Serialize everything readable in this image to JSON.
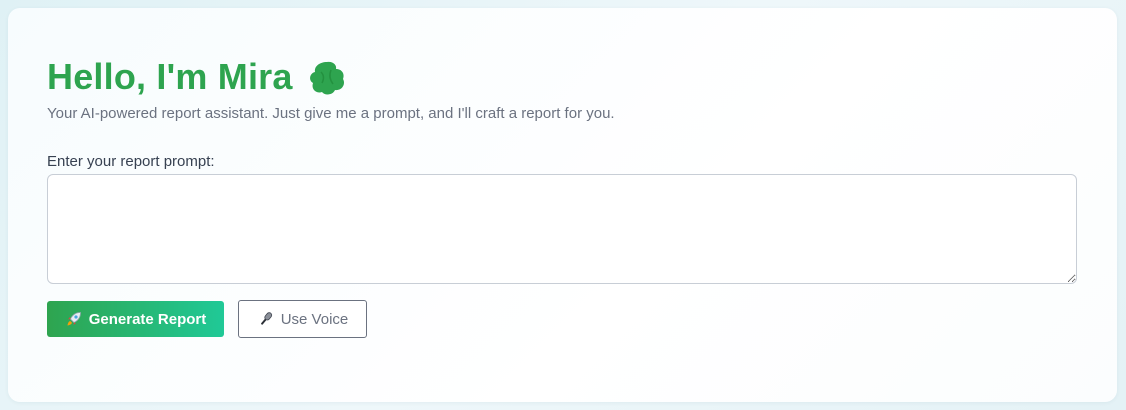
{
  "header": {
    "title": "Hello, I'm Mira",
    "title_icon": "leaf-blob-icon",
    "subtitle": "Your AI-powered report assistant. Just give me a prompt, and I'll craft a report for you."
  },
  "prompt": {
    "label": "Enter your report prompt:",
    "value": "",
    "placeholder": ""
  },
  "actions": {
    "generate": {
      "label": "Generate Report",
      "icon": "rocket-icon"
    },
    "voice": {
      "label": "Use Voice",
      "icon": "microphone-icon"
    }
  },
  "colors": {
    "accent": "#2ea44f",
    "accent_gradient_end": "#20c997",
    "muted_text": "#6b7280",
    "label_text": "#374151"
  }
}
